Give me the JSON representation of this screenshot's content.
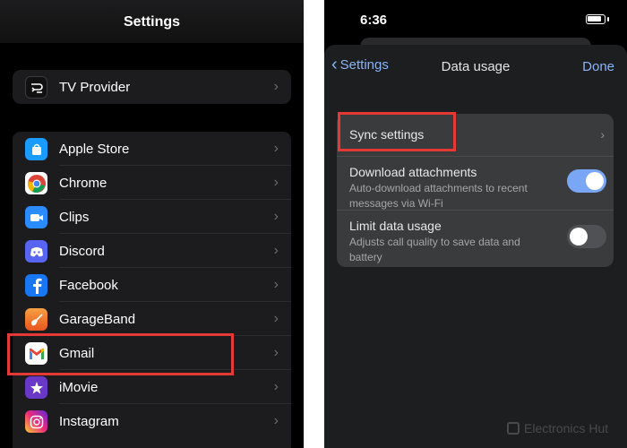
{
  "left": {
    "title": "Settings",
    "tv_provider": {
      "label": "TV Provider",
      "icon": "tv-provider-icon"
    },
    "apps": [
      {
        "label": "Apple Store",
        "icon": "apple-store-icon",
        "color": "#1a9bff"
      },
      {
        "label": "Chrome",
        "icon": "chrome-icon",
        "color": "#ffffff"
      },
      {
        "label": "Clips",
        "icon": "clips-icon",
        "color": "#2b8cff"
      },
      {
        "label": "Discord",
        "icon": "discord-icon",
        "color": "#5865f2"
      },
      {
        "label": "Facebook",
        "icon": "facebook-icon",
        "color": "#1877f2"
      },
      {
        "label": "GarageBand",
        "icon": "garageband-icon",
        "color": "#f47a22"
      },
      {
        "label": "Gmail",
        "icon": "gmail-icon",
        "color": "#ffffff"
      },
      {
        "label": "iMovie",
        "icon": "imovie-icon",
        "color": "#6a38c7"
      },
      {
        "label": "Instagram",
        "icon": "instagram-icon",
        "color": "#d6249f"
      }
    ]
  },
  "right": {
    "status_time": "6:36",
    "nav": {
      "back_label": "Settings",
      "title": "Data usage",
      "done_label": "Done"
    },
    "rows": {
      "sync": {
        "title": "Sync settings"
      },
      "download": {
        "title": "Download attachments",
        "subtitle": "Auto-download attachments to recent messages via Wi-Fi",
        "enabled": true
      },
      "limit": {
        "title": "Limit data usage",
        "subtitle": "Adjusts call quality to save data and battery",
        "enabled": false
      }
    }
  },
  "colors": {
    "highlight": "#e53935",
    "toggle_on": "#7aa7f5",
    "link": "#8ab4f8"
  },
  "watermark": "Electronics Hut"
}
